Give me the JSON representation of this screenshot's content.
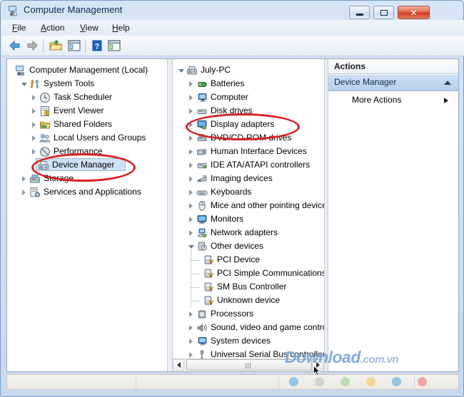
{
  "window": {
    "title": "Computer Management",
    "icon": "computer-management-icon",
    "controls": {
      "minimize": "Minimize",
      "maximize": "Maximize",
      "close": "Close",
      "close_glyph": "✕"
    }
  },
  "menu": [
    {
      "label": "File",
      "accel": "F"
    },
    {
      "label": "Action",
      "accel": "A"
    },
    {
      "label": "View",
      "accel": "V"
    },
    {
      "label": "Help",
      "accel": "H"
    }
  ],
  "toolbar": [
    {
      "name": "back-button",
      "tooltip": "Back"
    },
    {
      "name": "forward-button",
      "tooltip": "Forward"
    },
    {
      "name": "up-folder-button",
      "tooltip": "Up One Level"
    },
    {
      "name": "show-hide-console-tree-button",
      "tooltip": "Show/Hide Console Tree"
    },
    {
      "name": "help-button",
      "tooltip": "Help"
    },
    {
      "name": "show-hide-action-pane-button",
      "tooltip": "Show/Hide Action Pane"
    }
  ],
  "console_tree": {
    "root": {
      "label": "Computer Management (Local)",
      "icon": "computer-icon",
      "level": 0,
      "twisty": "none"
    },
    "items": [
      {
        "label": "System Tools",
        "icon": "system-tools-icon",
        "level": 1,
        "twisty": "expanded"
      },
      {
        "label": "Task Scheduler",
        "icon": "clock-icon",
        "level": 2,
        "twisty": "collapsed"
      },
      {
        "label": "Event Viewer",
        "icon": "event-viewer-icon",
        "level": 2,
        "twisty": "collapsed"
      },
      {
        "label": "Shared Folders",
        "icon": "shared-folders-icon",
        "level": 2,
        "twisty": "collapsed"
      },
      {
        "label": "Local Users and Groups",
        "icon": "users-icon",
        "level": 2,
        "twisty": "collapsed"
      },
      {
        "label": "Performance",
        "icon": "performance-icon",
        "level": 2,
        "twisty": "collapsed"
      },
      {
        "label": "Device Manager",
        "icon": "device-manager-icon",
        "level": 2,
        "twisty": "none",
        "selected": true
      },
      {
        "label": "Storage",
        "icon": "storage-icon",
        "level": 1,
        "twisty": "collapsed"
      },
      {
        "label": "Services and Applications",
        "icon": "services-icon",
        "level": 1,
        "twisty": "collapsed"
      }
    ]
  },
  "device_tree": {
    "root": {
      "label": "July-PC",
      "icon": "pc-icon",
      "level": 0,
      "twisty": "expanded"
    },
    "items": [
      {
        "label": "Batteries",
        "icon": "battery-icon",
        "level": 1,
        "twisty": "collapsed"
      },
      {
        "label": "Computer",
        "icon": "computer-icon",
        "level": 1,
        "twisty": "collapsed"
      },
      {
        "label": "Disk drives",
        "icon": "disk-icon",
        "level": 1,
        "twisty": "collapsed"
      },
      {
        "label": "Display adapters",
        "icon": "display-icon",
        "level": 1,
        "twisty": "collapsed",
        "annotated": true
      },
      {
        "label": "DVD/CD-ROM drives",
        "icon": "dvd-icon",
        "level": 1,
        "twisty": "collapsed"
      },
      {
        "label": "Human Interface Devices",
        "icon": "hid-icon",
        "level": 1,
        "twisty": "collapsed"
      },
      {
        "label": "IDE ATA/ATAPI controllers",
        "icon": "ide-icon",
        "level": 1,
        "twisty": "collapsed"
      },
      {
        "label": "Imaging devices",
        "icon": "imaging-icon",
        "level": 1,
        "twisty": "collapsed"
      },
      {
        "label": "Keyboards",
        "icon": "keyboard-icon",
        "level": 1,
        "twisty": "collapsed"
      },
      {
        "label": "Mice and other pointing devices",
        "icon": "mouse-icon",
        "level": 1,
        "twisty": "collapsed"
      },
      {
        "label": "Monitors",
        "icon": "monitor-icon",
        "level": 1,
        "twisty": "collapsed"
      },
      {
        "label": "Network adapters",
        "icon": "network-icon",
        "level": 1,
        "twisty": "collapsed"
      },
      {
        "label": "Other devices",
        "icon": "unknown-icon",
        "level": 1,
        "twisty": "expanded"
      },
      {
        "label": "PCI Device",
        "icon": "warning-device-icon",
        "level": 2,
        "twisty": "none"
      },
      {
        "label": "PCI Simple Communications Controller",
        "icon": "warning-device-icon",
        "level": 2,
        "twisty": "none"
      },
      {
        "label": "SM Bus Controller",
        "icon": "warning-device-icon",
        "level": 2,
        "twisty": "none"
      },
      {
        "label": "Unknown device",
        "icon": "warning-device-icon",
        "level": 2,
        "twisty": "none"
      },
      {
        "label": "Processors",
        "icon": "processor-icon",
        "level": 1,
        "twisty": "collapsed"
      },
      {
        "label": "Sound, video and game controllers",
        "icon": "sound-icon",
        "level": 1,
        "twisty": "collapsed"
      },
      {
        "label": "System devices",
        "icon": "system-icon",
        "level": 1,
        "twisty": "collapsed"
      },
      {
        "label": "Universal Serial Bus controllers",
        "icon": "usb-icon",
        "level": 1,
        "twisty": "collapsed"
      }
    ]
  },
  "actions": {
    "header": "Actions",
    "group": "Device Manager",
    "more": "More Actions"
  },
  "scrollbar": {
    "left_arrow": "scroll-left",
    "right_arrow": "scroll-right"
  },
  "watermark": {
    "main": "Download",
    "suffix": ".com.vn"
  },
  "annotations": [
    {
      "name": "device-manager-highlight",
      "target": "Device Manager",
      "color": "#d81f1f",
      "shape": "ellipse"
    },
    {
      "name": "display-adapters-highlight",
      "target": "Display adapters",
      "color": "#d81f1f",
      "shape": "ellipse"
    }
  ],
  "colors": {
    "accent": "#cfe2f7",
    "annotation": "#d81f1f",
    "title_text": "#0b2a4a",
    "close_button": "#cf3d21"
  }
}
